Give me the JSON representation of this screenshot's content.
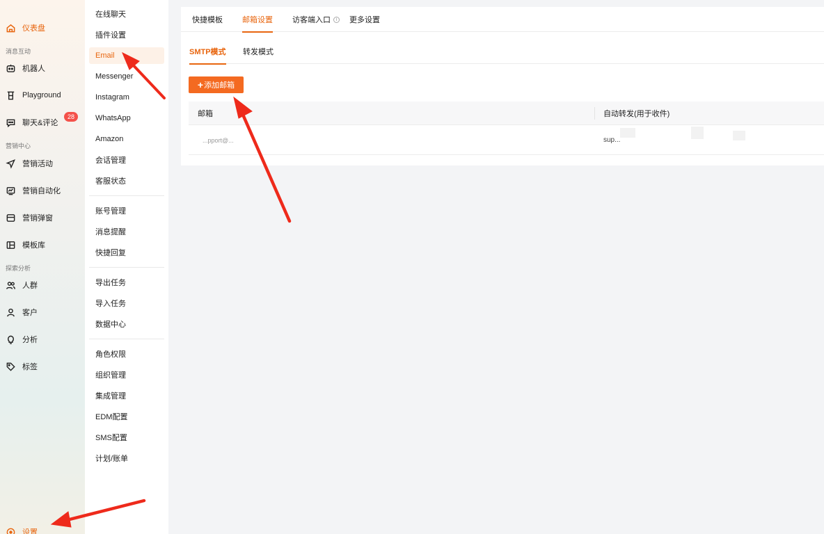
{
  "sidebar": {
    "items": [
      {
        "label": "仪表盘",
        "icon": "home-icon",
        "active": true
      },
      {
        "label": "机器人",
        "icon": "robot-icon"
      },
      {
        "label": "Playground",
        "icon": "flask-icon"
      },
      {
        "label": "聊天&评论",
        "icon": "chat-icon",
        "badge": "28"
      },
      {
        "label": "营销活动",
        "icon": "send-icon"
      },
      {
        "label": "营销自动化",
        "icon": "automation-icon"
      },
      {
        "label": "营销弹窗",
        "icon": "popup-icon"
      },
      {
        "label": "模板库",
        "icon": "template-icon"
      },
      {
        "label": "人群",
        "icon": "users-icon"
      },
      {
        "label": "客户",
        "icon": "user-icon"
      },
      {
        "label": "分析",
        "icon": "bulb-icon"
      },
      {
        "label": "标签",
        "icon": "tag-icon"
      },
      {
        "label": "设置",
        "icon": "settings-icon",
        "active": true
      }
    ],
    "sections": [
      "消息互动",
      "营销中心",
      "探索分析"
    ]
  },
  "submenu": {
    "items": [
      "在线聊天",
      "插件设置",
      "Email",
      "Messenger",
      "Instagram",
      "WhatsApp",
      "Amazon",
      "会话管理",
      "客服状态",
      "账号管理",
      "消息提醒",
      "快捷回复",
      "导出任务",
      "导入任务",
      "数据中心",
      "角色权限",
      "组织管理",
      "集成管理",
      "EDM配置",
      "SMS配置",
      "计划/账单"
    ],
    "active": "Email"
  },
  "main": {
    "tabs": [
      "快捷模板",
      "邮箱设置",
      "访客端入口",
      "更多设置"
    ],
    "active_tab": "邮箱设置",
    "sub_tabs": [
      "SMTP模式",
      "转发模式"
    ],
    "active_sub_tab": "SMTP模式",
    "add_button": "添加邮箱",
    "add_button_icon": "plus-icon",
    "table": {
      "columns": [
        "邮箱",
        "自动转发(用于收件)"
      ],
      "rows": [
        {
          "email": "...pport@...",
          "forward": "sup..."
        }
      ]
    }
  },
  "colors": {
    "accent": "#e8650e",
    "button": "#f46a21",
    "badge": "#f4514a",
    "annotation": "#ee2a1b"
  }
}
